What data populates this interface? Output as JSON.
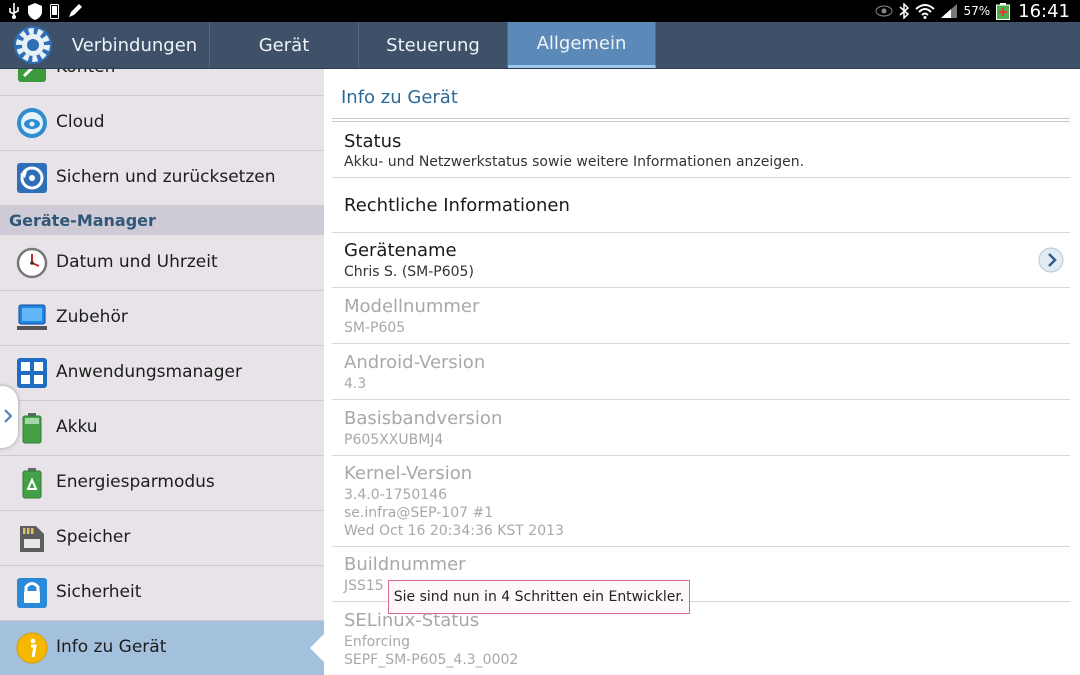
{
  "statusbar": {
    "icons_left": [
      "usb-icon",
      "shield-icon",
      "phone-icon",
      "pen-icon"
    ],
    "icons_right": [
      "eye-icon",
      "bluetooth-icon",
      "wifi-icon",
      "signal-icon"
    ],
    "battery": "57%",
    "time": "16:41"
  },
  "tabs": [
    {
      "label": "Verbindungen"
    },
    {
      "label": "Gerät"
    },
    {
      "label": "Steuerung"
    },
    {
      "label": "Allgemein",
      "active": true
    }
  ],
  "sidebar": {
    "partial_item": "Konten",
    "items_top": [
      {
        "label": "Cloud",
        "icon": "cloud-icon"
      },
      {
        "label": "Sichern und zurücksetzen",
        "icon": "backup-icon"
      }
    ],
    "section_header": "Geräte-Manager",
    "items": [
      {
        "label": "Datum und Uhrzeit",
        "icon": "clock-icon"
      },
      {
        "label": "Zubehör",
        "icon": "monitor-icon"
      },
      {
        "label": "Anwendungsmanager",
        "icon": "apps-icon"
      },
      {
        "label": "Akku",
        "icon": "battery-icon"
      },
      {
        "label": "Energiesparmodus",
        "icon": "recycle-icon"
      },
      {
        "label": "Speicher",
        "icon": "sdcard-icon"
      },
      {
        "label": "Sicherheit",
        "icon": "lock-icon"
      },
      {
        "label": "Info zu Gerät",
        "icon": "info-icon",
        "active": true
      }
    ]
  },
  "content": {
    "title": "Info zu Gerät",
    "rows": [
      {
        "title": "Status",
        "subtitle": "Akku- und Netzwerkstatus sowie weitere Informationen anzeigen."
      },
      {
        "title": "Rechtliche Informationen"
      },
      {
        "title": "Gerätename",
        "subtitle": "Chris S. (SM-P605)"
      },
      {
        "title": "Modellnummer",
        "subtitle": "SM-P605"
      },
      {
        "title": "Android-Version",
        "subtitle": "4.3"
      },
      {
        "title": "Basisbandversion",
        "subtitle": "P605XXUBMJ4"
      },
      {
        "title": "Kernel-Version",
        "subtitle_lines": [
          "3.4.0-1750146",
          "se.infra@SEP-107 #1",
          "Wed Oct 16 20:34:36 KST 2013"
        ]
      },
      {
        "title": "Buildnummer",
        "subtitle": "JSS15"
      },
      {
        "title": "SELinux-Status",
        "subtitle_lines": [
          "Enforcing",
          "SEPF_SM-P605_4.3_0002"
        ]
      }
    ]
  },
  "toast": "Sie sind nun in 4 Schritten ein Entwickler.",
  "colors": {
    "tabbar": "#3e5168",
    "tab_active": "#5c8ab8",
    "sidebar_bg": "#e7e3e8",
    "sidebar_active": "#a3c0dd",
    "section_header_text": "#2f5778",
    "content_title": "#2b6a96"
  }
}
